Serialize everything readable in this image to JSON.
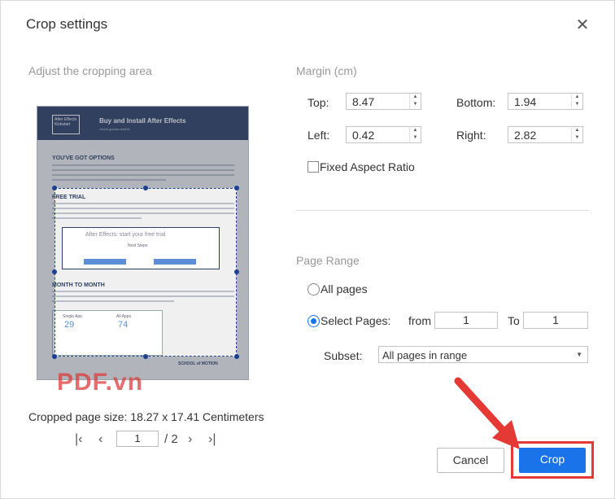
{
  "dialog": {
    "title": "Crop settings",
    "close_icon": "close-icon"
  },
  "preview": {
    "label": "Adjust the cropping area",
    "doc": {
      "logo_text": "After Effects Kickstart",
      "header_title": "Buy and Install After Effects",
      "header_sub": "You're gonna need it!",
      "h1": "YOU'VE GOT OPTIONS",
      "h2": "FREE TRIAL",
      "trial_box": "After Effects: start your free trial",
      "next_steps": "Next Steps",
      "h3": "MONTH TO MONTH",
      "plan1_name": "Single App",
      "plan1_price": "29",
      "plan2_name": "All Apps",
      "plan2_price": "74",
      "footer_logo": "SCHOOL of MOTION"
    },
    "watermark": "PDF.vn",
    "cropped_size": "Cropped page size: 18.27 x 17.41 Centimeters"
  },
  "pager": {
    "first_icon": "first-page-icon",
    "prev_icon": "prev-page-icon",
    "next_icon": "next-page-icon",
    "last_icon": "last-page-icon",
    "current_page": "1",
    "total": "/ 2"
  },
  "margin": {
    "label": "Margin (cm)",
    "top_label": "Top:",
    "top_value": "8.47",
    "bottom_label": "Bottom:",
    "bottom_value": "1.94",
    "left_label": "Left:",
    "left_value": "0.42",
    "right_label": "Right:",
    "right_value": "2.82",
    "fixed_aspect_label": "Fixed Aspect Ratio",
    "fixed_aspect_checked": false
  },
  "page_range": {
    "label": "Page Range",
    "all_pages_label": "All pages",
    "select_pages_label": "Select Pages:",
    "select_pages_selected": true,
    "from_label": "from",
    "from_value": "1",
    "to_label": "To",
    "to_value": "1",
    "subset_label": "Subset:",
    "subset_value": "All pages in range"
  },
  "buttons": {
    "cancel": "Cancel",
    "crop": "Crop"
  },
  "colors": {
    "accent": "#1a73e8",
    "highlight": "#e53935"
  }
}
